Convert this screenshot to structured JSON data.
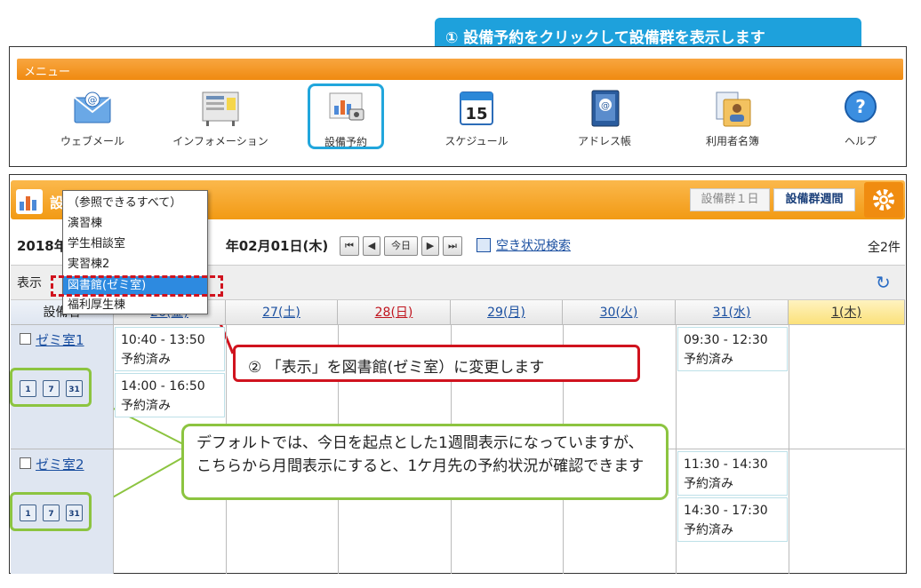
{
  "callouts": {
    "step1": "① 設備予約をクリックして設備群を表示します",
    "step2": "② 「表示」を図書館(ゼミ室）に変更します",
    "note": "デフォルトでは、今日を起点とした1週間表示になっていますが、こちらから月間表示にすると、1ケ月先の予約状況が確認できます"
  },
  "menu": {
    "title": "メニュー",
    "items": [
      {
        "label": "ウェブメール",
        "icon": "webmail-icon"
      },
      {
        "label": "インフォメーション",
        "icon": "information-board-icon"
      },
      {
        "label": "設備予約",
        "icon": "facility-reservation-icon"
      },
      {
        "label": "スケジュール",
        "icon": "calendar-icon"
      },
      {
        "label": "アドレス帳",
        "icon": "address-book-icon"
      },
      {
        "label": "利用者名簿",
        "icon": "user-directory-icon"
      },
      {
        "label": "ヘルプ",
        "icon": "help-icon"
      }
    ]
  },
  "panel": {
    "title": "設",
    "group_day": "設備群１日",
    "group_week": "設備群週間",
    "date_start": "2018年",
    "date_end": "年02月01日(木)",
    "today_btn": "今日",
    "vacancy_search": "空き状況検索",
    "total": "全2件",
    "display_label": "表示",
    "facility_col": "設備名"
  },
  "dropdown": {
    "items": [
      "（参照できるすべて）",
      "演習棟",
      "学生相談室",
      "実習棟2",
      "図書館(ゼミ室)",
      "福利厚生棟"
    ],
    "selected_index": 4
  },
  "calendar": {
    "days": [
      "26(金)",
      "27(土)",
      "28(日)",
      "29(月)",
      "30(火)",
      "31(水)",
      "1(木)"
    ],
    "rooms": [
      {
        "name": "ゼミ室1",
        "reservations": [
          {
            "day": "26(金)",
            "time": "10:40 - 13:50",
            "status": "予約済み"
          },
          {
            "day": "26(金)",
            "time": "14:00 - 16:50",
            "status": "予約済み"
          },
          {
            "day": "31(水)",
            "time": "09:30 - 12:30",
            "status": "予約済み"
          }
        ]
      },
      {
        "name": "ゼミ室2",
        "reservations": [
          {
            "day": "31(水)",
            "time": "11:30 - 14:30",
            "status": "予約済み"
          },
          {
            "day": "31(水)",
            "time": "14:30 - 17:30",
            "status": "予約済み"
          }
        ]
      }
    ],
    "view_icons": [
      "1",
      "7",
      "31"
    ]
  },
  "colors": {
    "accent_orange": "#f29a14",
    "callout_blue": "#1ea1dc",
    "callout_red": "#d0131e",
    "callout_green": "#8cc440",
    "link_blue": "#1a4fa0"
  }
}
